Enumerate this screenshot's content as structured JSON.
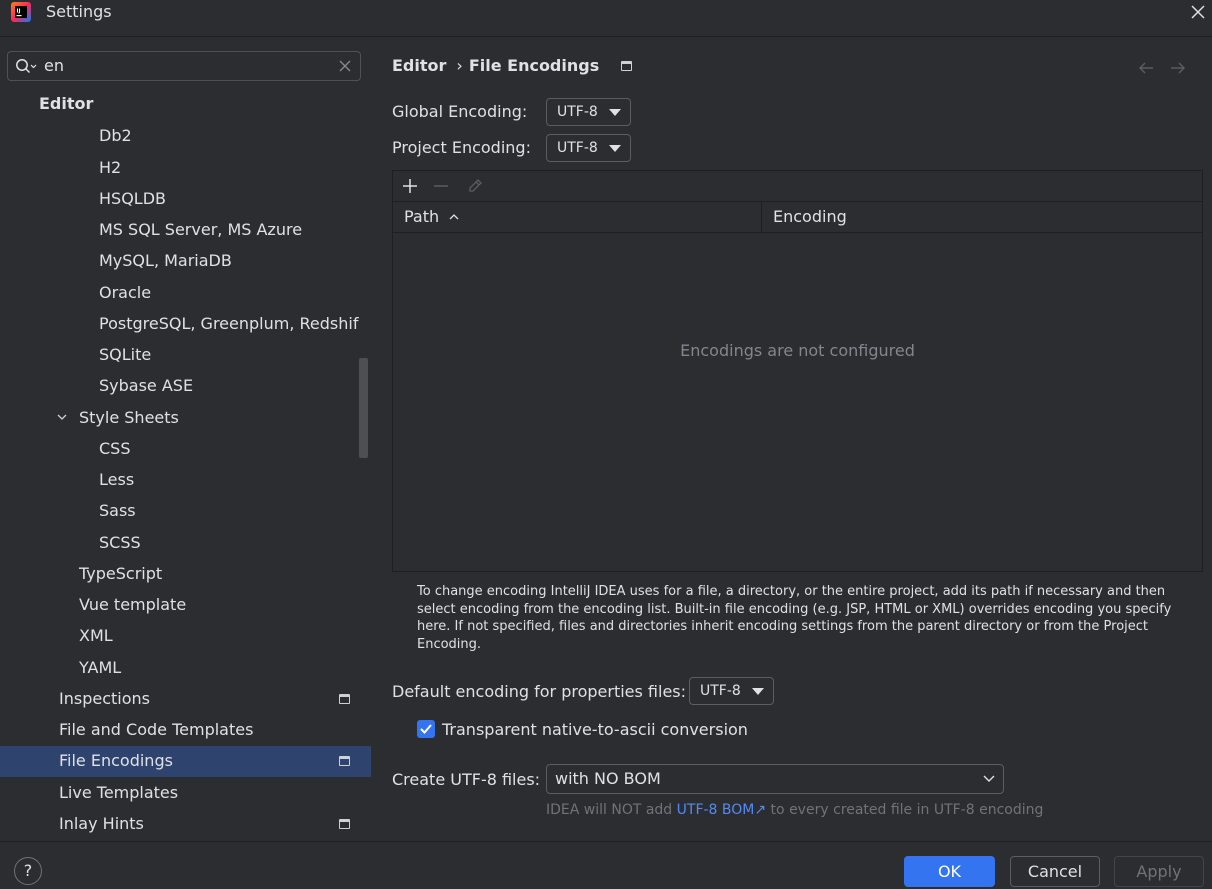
{
  "window": {
    "title": "Settings",
    "app_icon": "intellij-idea-icon",
    "close_icon": "close-icon"
  },
  "sidebar": {
    "search": {
      "value": "en",
      "icon": "search-icon",
      "clear_icon": "clear-icon"
    },
    "items": [
      {
        "label": "Editor",
        "level": 0,
        "icon": null
      },
      {
        "label": "Db2",
        "level": 3
      },
      {
        "label": "H2",
        "level": 3
      },
      {
        "label": "HSQLDB",
        "level": 3
      },
      {
        "label": "MS SQL Server, MS Azure",
        "level": 3
      },
      {
        "label": "MySQL, MariaDB",
        "level": 3
      },
      {
        "label": "Oracle",
        "level": 3
      },
      {
        "label": "PostgreSQL, Greenplum, Redshif",
        "level": 3
      },
      {
        "label": "SQLite",
        "level": 3
      },
      {
        "label": "Sybase ASE",
        "level": 3
      },
      {
        "label": "Style Sheets",
        "level": 2,
        "expanded": true
      },
      {
        "label": "CSS",
        "level": 3
      },
      {
        "label": "Less",
        "level": 3
      },
      {
        "label": "Sass",
        "level": 3
      },
      {
        "label": "SCSS",
        "level": 3
      },
      {
        "label": "TypeScript",
        "level": 2
      },
      {
        "label": "Vue template",
        "level": 2
      },
      {
        "label": "XML",
        "level": 2
      },
      {
        "label": "YAML",
        "level": 2
      },
      {
        "label": "Inspections",
        "level": 1,
        "page_icon": true
      },
      {
        "label": "File and Code Templates",
        "level": 1
      },
      {
        "label": "File Encodings",
        "level": 1,
        "page_icon": true,
        "selected": true
      },
      {
        "label": "Live Templates",
        "level": 1
      },
      {
        "label": "Inlay Hints",
        "level": 1,
        "page_icon": true
      }
    ]
  },
  "breadcrumb": {
    "parent": "Editor",
    "separator": "›",
    "current": "File Encodings"
  },
  "global_encoding": {
    "label": "Global Encoding:",
    "value": "UTF-8"
  },
  "project_encoding": {
    "label": "Project Encoding:",
    "value": "UTF-8"
  },
  "table": {
    "columns": [
      "Path",
      "Encoding"
    ],
    "empty_text": "Encodings are not configured",
    "toolbar": [
      "add-icon",
      "remove-icon",
      "edit-icon"
    ]
  },
  "help_text": "To change encoding IntelliJ IDEA uses for a file, a directory, or the entire project, add its path if necessary and then select encoding from the encoding list. Built-in file encoding (e.g. JSP, HTML or XML) overrides encoding you specify here. If not specified, files and directories inherit encoding settings from the parent directory or from the Project Encoding.",
  "properties": {
    "label": "Default encoding for properties files:",
    "value": "UTF-8"
  },
  "native_to_ascii": {
    "label": "Transparent native-to-ascii conversion",
    "checked": true
  },
  "utf8_files": {
    "label": "Create UTF-8 files:",
    "value": "with NO BOM"
  },
  "hint": {
    "prefix": "IDEA will NOT add ",
    "link": "UTF-8 BOM",
    "link_arrow": "↗",
    "suffix": " to every created file in UTF-8 encoding"
  },
  "footer": {
    "help": "?",
    "ok": "OK",
    "cancel": "Cancel",
    "apply": "Apply"
  },
  "colors": {
    "background": "#2b2d30",
    "selection": "#2e436e",
    "accent": "#3574f0",
    "link": "#548af7",
    "muted": "#6f737a"
  }
}
